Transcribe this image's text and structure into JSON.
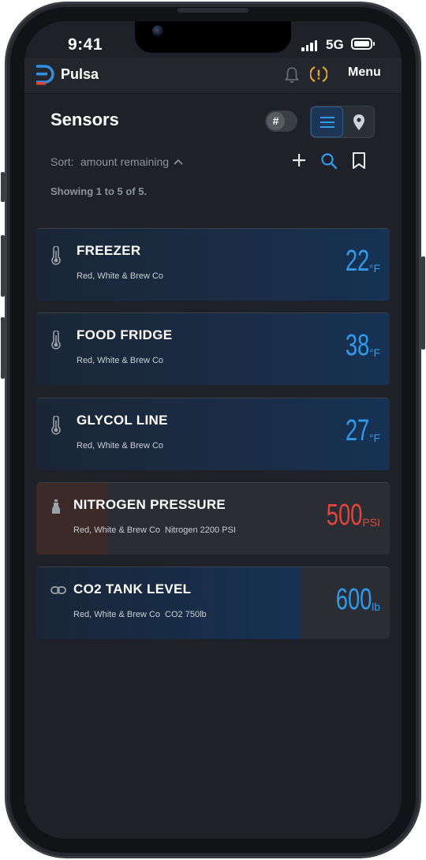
{
  "status_bar": {
    "time": "9:41",
    "network": "5G"
  },
  "header": {
    "brand": "Pulsa",
    "menu_label": "Menu"
  },
  "page": {
    "title": "Sensors",
    "hash_toggle": "#",
    "sort_label": "Sort:",
    "sort_value": "amount remaining",
    "showing": "Showing 1 to 5 of 5."
  },
  "sensors": [
    {
      "name": "FREEZER",
      "location": "Red, White & Brew Co",
      "detail": "",
      "value": "22",
      "unit": "°F",
      "icon": "thermometer-icon"
    },
    {
      "name": "FOOD FRIDGE",
      "location": "Red, White & Brew Co",
      "detail": "",
      "value": "38",
      "unit": "°F",
      "icon": "thermometer-icon"
    },
    {
      "name": "GLYCOL LINE",
      "location": "Red, White & Brew Co",
      "detail": "",
      "value": "27",
      "unit": "°F",
      "icon": "thermometer-icon"
    },
    {
      "name": "NITROGEN PRESSURE",
      "location": "Red, White & Brew Co",
      "detail": "Nitrogen 2200 PSI",
      "value": "500",
      "unit": "PSI",
      "icon": "gas-tank-icon",
      "level": 0.2
    },
    {
      "name": "CO2 TANK LEVEL",
      "location": "Red, White & Brew Co",
      "detail": "CO2 750lb",
      "value": "600",
      "unit": "lb",
      "icon": "link-icon",
      "level": 0.75
    }
  ],
  "colors": {
    "accent_blue": "#2f9bea",
    "alert_red": "#e0453a",
    "alert_yellow": "#e9a825",
    "background": "#1e2228"
  }
}
